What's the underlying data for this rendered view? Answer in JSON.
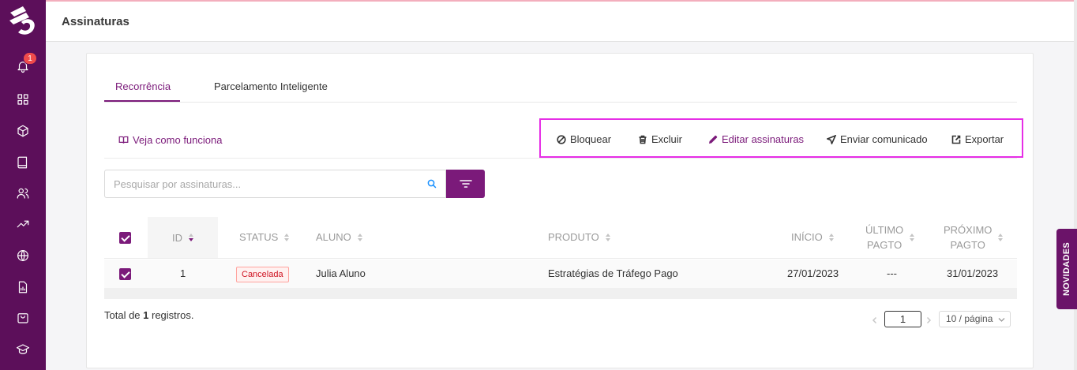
{
  "header": {
    "title": "Assinaturas"
  },
  "sidebar": {
    "notification_count": "1",
    "items": [
      "bell-icon",
      "dashboard-icon",
      "box-icon",
      "book-icon",
      "users-icon",
      "trending-up-icon",
      "globe-icon",
      "report-icon",
      "shopping-bag-icon",
      "graduation-cap-icon"
    ]
  },
  "tabs": [
    {
      "label": "Recorrência",
      "active": true
    },
    {
      "label": "Parcelamento Inteligente",
      "active": false
    }
  ],
  "howto": {
    "label": "Veja como funciona"
  },
  "actions": {
    "block": "Bloquear",
    "delete": "Excluir",
    "edit": "Editar assinaturas",
    "send": "Enviar comunicado",
    "export": "Exportar"
  },
  "search": {
    "placeholder": "Pesquisar por assinaturas...",
    "value": ""
  },
  "table": {
    "headers": {
      "id": "ID",
      "status": "STATUS",
      "student": "ALUNO",
      "product": "PRODUTO",
      "start": "INÍCIO",
      "last_paid_1": "ÚLTIMO",
      "last_paid_2": "PAGTO",
      "next_paid_1": "PRÓXIMO",
      "next_paid_2": "PAGTO"
    },
    "rows": [
      {
        "id": "1",
        "status": "Cancelada",
        "student": "Julia Aluno",
        "product": "Estratégias de Tráfego Pago",
        "start": "27/01/2023",
        "last_paid": "---",
        "next_paid": "31/01/2023"
      }
    ]
  },
  "footer": {
    "total_prefix": "Total de ",
    "total_count": "1",
    "total_suffix": " registros.",
    "current_page": "1",
    "page_size": "10 / página"
  },
  "side_tab": {
    "label": "NOVIDADES"
  },
  "colors": {
    "primary": "#7b1a7a",
    "sidebar": "#5c0f5a",
    "highlight": "#e62ee6",
    "danger": "#cf1322"
  }
}
